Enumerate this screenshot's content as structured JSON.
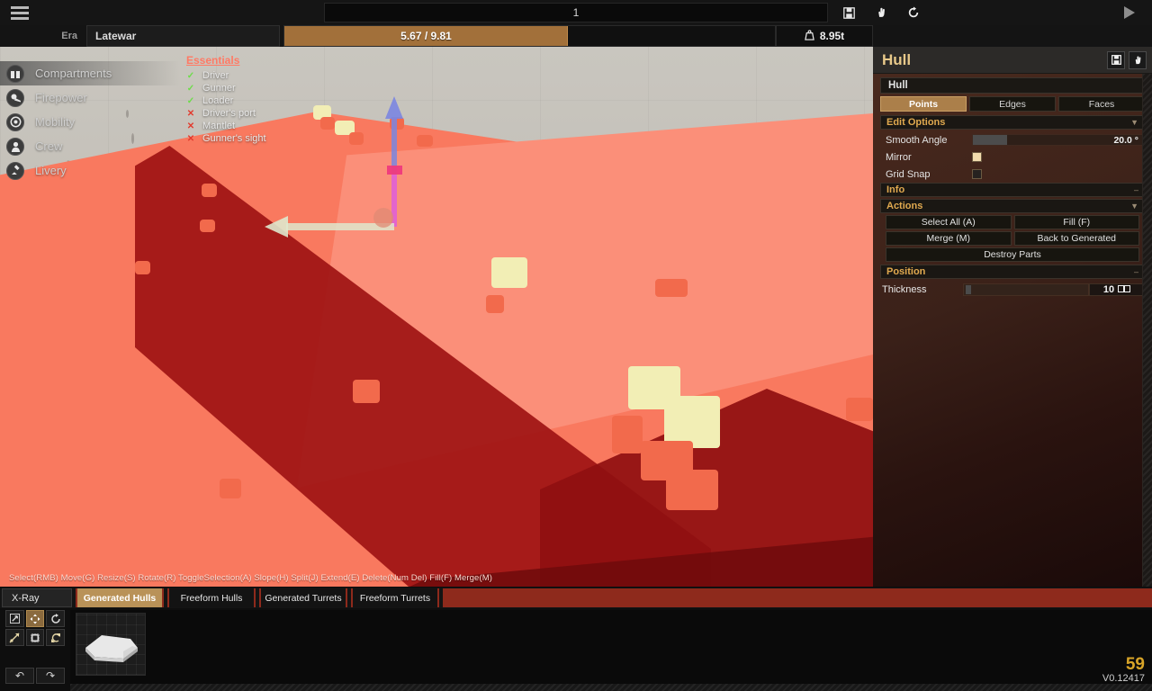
{
  "topbar": {
    "menu_icon": "hamburger-icon",
    "vehicle_name": "1",
    "icons": [
      {
        "name": "save-icon",
        "glyph": "floppy"
      },
      {
        "name": "hand-icon",
        "glyph": "hand"
      },
      {
        "name": "refresh-icon",
        "glyph": "circle-arrow"
      }
    ],
    "play_icon": "play-icon"
  },
  "statusbar": {
    "era_label": "Era",
    "era_value": "Latewar",
    "cost_text": "5.67 / 9.81",
    "cost_percent": 57.8,
    "weight_text": "8.95t",
    "weight_icon": "weight-icon"
  },
  "nav": {
    "items": [
      {
        "label": "Compartments",
        "icon": "box-icon",
        "active": true
      },
      {
        "label": "Firepower",
        "icon": "cannon-icon",
        "active": false
      },
      {
        "label": "Mobility",
        "icon": "wheel-icon",
        "active": false
      },
      {
        "label": "Crew",
        "icon": "person-icon",
        "active": false
      },
      {
        "label": "Livery",
        "icon": "paintbrush-icon",
        "active": false
      }
    ]
  },
  "essentials": {
    "title": "Essentials",
    "items": [
      {
        "name": "Driver",
        "ok": true
      },
      {
        "name": "Gunner",
        "ok": true
      },
      {
        "name": "Loader",
        "ok": true
      },
      {
        "name": "Driver's port",
        "ok": false
      },
      {
        "name": "Mantlet",
        "ok": false
      },
      {
        "name": "Gunner's sight",
        "ok": false
      }
    ],
    "mark_ok": "✓",
    "mark_no": "✕"
  },
  "viewport": {
    "hints": "Select(RMB) Move(G) Resize(S) Rotate(R) ToggleSelection(A) Slope(H) Split(J) Extend(E) Delete(Num Del) Fill(F) Merge(M)",
    "gizmo": {
      "name": "move-gizmo",
      "axis_up_color": "#7b86e0",
      "axis_mid_color": "#e060d8",
      "axis_left_color": "#dfe8cd"
    }
  },
  "inspector": {
    "title": "Hull",
    "header_buttons": [
      {
        "name": "save-hull-button",
        "icon": "floppy-icon"
      },
      {
        "name": "pick-hull-button",
        "icon": "hand-icon"
      }
    ],
    "name_field": "Hull",
    "mode_tabs": [
      {
        "label": "Points",
        "active": true
      },
      {
        "label": "Edges",
        "active": false
      },
      {
        "label": "Faces",
        "active": false
      }
    ],
    "sections": {
      "edit_options": {
        "title": "Edit Options",
        "collapse_glyph": "▼"
      },
      "info": {
        "title": "Info",
        "collapse_glyph": "–"
      },
      "actions": {
        "title": "Actions",
        "collapse_glyph": "▼"
      },
      "position": {
        "title": "Position",
        "collapse_glyph": "–"
      }
    },
    "smooth_angle": {
      "label": "Smooth Angle",
      "value": "20.0 °",
      "fill_percent": 20
    },
    "mirror": {
      "label": "Mirror",
      "checked": true
    },
    "grid_snap": {
      "label": "Grid Snap",
      "checked": false
    },
    "actions": [
      {
        "label": "Select All (A)"
      },
      {
        "label": "Fill (F)"
      },
      {
        "label": "Merge (M)"
      },
      {
        "label": "Back to Generated"
      },
      {
        "label": "Destroy Parts"
      }
    ],
    "thickness": {
      "label": "Thickness",
      "value": "10",
      "unit_icon": "armor-icon",
      "fill_percent": 4
    }
  },
  "bottom": {
    "xray_label": "X-Ray",
    "tabs": [
      {
        "label": "Generated Hulls",
        "active": true
      },
      {
        "label": "Freeform Hulls",
        "active": false
      },
      {
        "label": "Generated Turrets",
        "active": false
      },
      {
        "label": "Freeform Turrets",
        "active": false
      }
    ],
    "tools_row1": [
      {
        "name": "scale-tool-button",
        "icon": "diagonal-arrow-icon",
        "active": false
      },
      {
        "name": "move-tool-button",
        "icon": "move-cross-icon",
        "active": true
      },
      {
        "name": "rotate-tool-button",
        "icon": "rotate-arc-icon",
        "active": false
      }
    ],
    "tools_row2": [
      {
        "name": "mirror-tool-button",
        "icon": "mirror-slash-icon",
        "active": false
      },
      {
        "name": "bounds-tool-button",
        "icon": "bounding-box-icon",
        "active": false
      },
      {
        "name": "flip-tool-button",
        "icon": "flip-arrows-icon",
        "active": false
      }
    ],
    "history": [
      {
        "name": "undo-button",
        "glyph": "↶"
      },
      {
        "name": "redo-button",
        "glyph": "↷"
      }
    ],
    "thumbnail_name": "hull-thumbnail"
  },
  "footer": {
    "fps": "59",
    "version": "V0.12417"
  }
}
